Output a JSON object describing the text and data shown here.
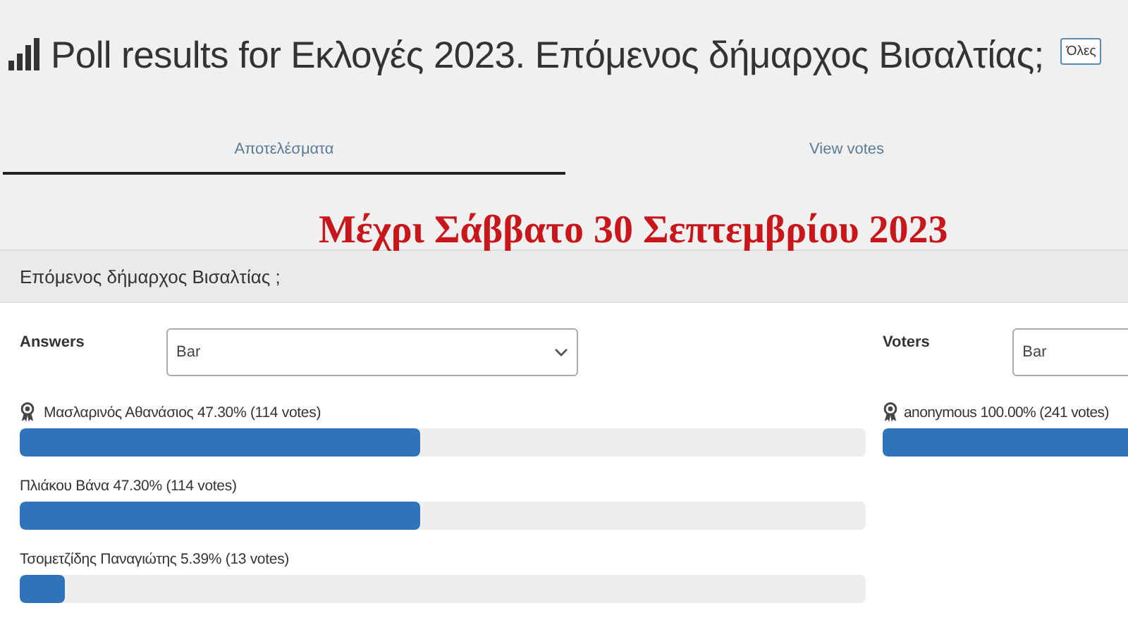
{
  "title": "Poll results for Εκλογές 2023. Επόμενος δήμαρχος Βισαλτίας;",
  "title_button": "Όλες",
  "tabs": [
    {
      "label": "Αποτελέσματα",
      "selected": true
    },
    {
      "label": "View votes",
      "selected": false
    }
  ],
  "overlay_text": "Μέχρι Σάββατο 30 Σεπτεμβρίου 2023",
  "question": "Επόμενος δήμαρχος Βισαλτίας ;",
  "answers": {
    "label": "Answers",
    "chart_select": "Bar",
    "rows": [
      {
        "text": "Μασλαρινός Αθανάσιος 47.30% (114 votes)",
        "award": true,
        "level": 0.473
      },
      {
        "text": "Πλιάκου Βάνα 47.30% (114 votes)",
        "award": false,
        "level": 0.473
      },
      {
        "text": "Τσομετζίδης Παναγιώτης 5.39% (13 votes)",
        "award": false,
        "level": 0.0539
      }
    ]
  },
  "voters": {
    "label": "Voters",
    "chart_select": "Bar",
    "rows": [
      {
        "text": "anonymous  100.00% (241 votes)",
        "award": true
      }
    ]
  }
}
